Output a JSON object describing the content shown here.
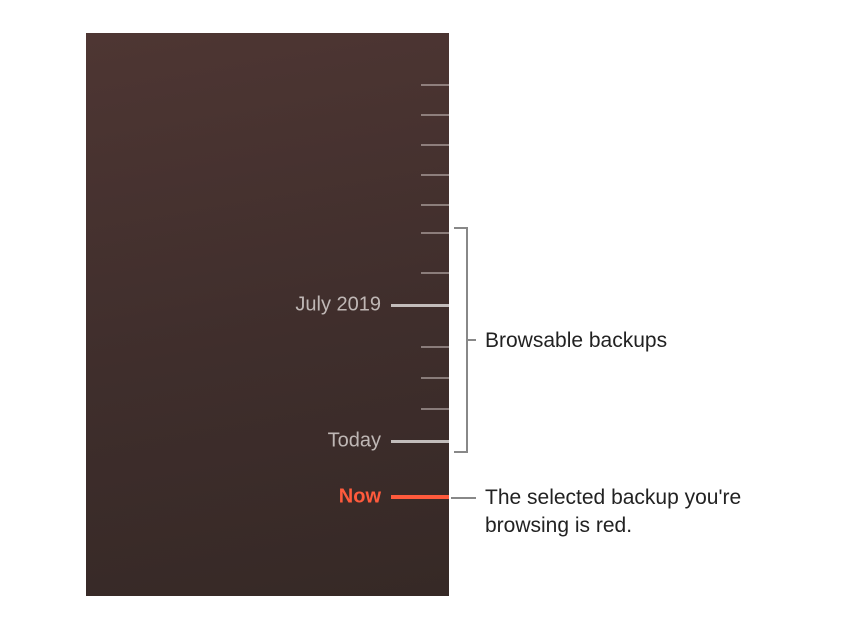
{
  "timeline": {
    "labels": {
      "july": "July 2019",
      "today": "Today",
      "now": "Now"
    }
  },
  "callouts": {
    "browsable": "Browsable backups",
    "selected": "The selected backup you're browsing is red."
  }
}
